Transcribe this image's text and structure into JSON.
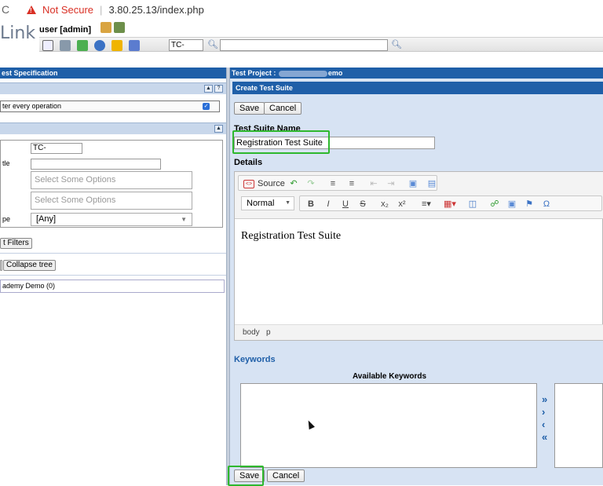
{
  "browser": {
    "security": "Not Secure",
    "url": "3.80.25.13/index.php"
  },
  "app": {
    "logo": "Link",
    "user": "user [admin]",
    "tc_prefix": "TC-"
  },
  "left_panel": {
    "header": "est Specification",
    "option_label": "ter every operation",
    "filters": {
      "tc_id_label": "",
      "tc_id_value": "TC-",
      "title_label": "tle",
      "select_placeholder_1": "Select Some Options",
      "select_placeholder_2": "Select Some Options",
      "type_label": "pe",
      "type_value": "[Any]"
    },
    "reset_filters": "t Filters",
    "expand_tree": "",
    "collapse_tree": "Collapse tree",
    "tree_root": "ademy Demo (0)"
  },
  "right_panel": {
    "project_label": "Test Project :",
    "project_suffix": "emo",
    "section_title": "Create Test Suite",
    "save": "Save",
    "cancel": "Cancel",
    "suite_name_label": "Test Suite Name",
    "suite_name_value": "Registration Test Suite",
    "details_label": "Details",
    "editor": {
      "source": "Source",
      "format": "Normal",
      "content": "Registration Test Suite",
      "path_body": "body",
      "path_p": "p"
    },
    "keywords_label": "Keywords",
    "available_keywords": "Available Keywords",
    "save_bottom": "Save",
    "cancel_bottom": "Cancel"
  },
  "colors": {
    "title_bar": "#1f5fa8",
    "panel_bg": "#d7e3f3",
    "highlight": "#2eb82e",
    "warning": "#d93025"
  }
}
